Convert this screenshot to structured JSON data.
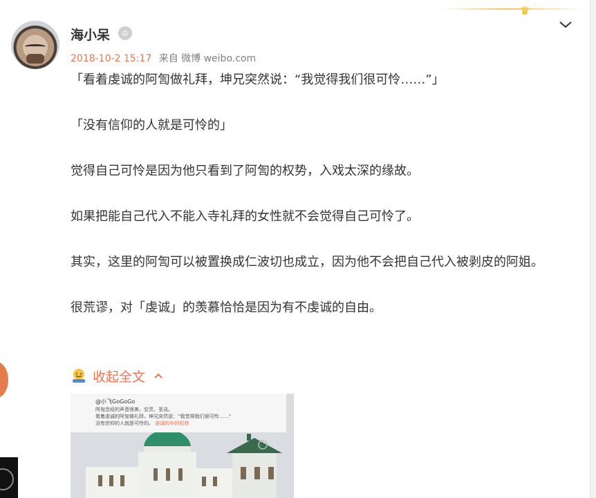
{
  "post": {
    "username": "海小呆",
    "badge_icon": "member-crown-icon",
    "timestamp": "2018-10-2 15:17",
    "source_prefix": "来自",
    "source": "微博 weibo.com",
    "paragraphs": [
      "「看着虔诚的阿訇做礼拜，坤兄突然说：“我觉得我们很可怜……”」",
      "「没有信仰的人就是可怜的」",
      "觉得自己可怜是因为他只看到了阿訇的权势，入戏太深的缘故。",
      "如果把能自己代入不能入寺礼拜的女性就不会觉得自己可怜了。",
      "其实，这里的阿訇可以被置换成仁波切也成立，因为他不会把自己代入被剥皮的阿姐。",
      "很荒谬，对「虔诚」的羡慕恰恰是因为有不虔诚的自由。"
    ],
    "collapse_label": "收起全文"
  },
  "thumbnail": {
    "caption_user": "@小飞GoGoGo",
    "caption_line1": "阿訇念经的声音很美，空灵、圣洁。",
    "caption_line2": "看着虔诚的阿訇做礼拜，坤兄突然说：“我觉得我们很可怜……”",
    "caption_line3": "没有信仰的人就是可怜的。",
    "caption_link": "虔诚的中的视频"
  },
  "colors": {
    "accent": "#eb7350",
    "text": "#333333",
    "meta": "#808080",
    "gold": "#f3c257"
  }
}
